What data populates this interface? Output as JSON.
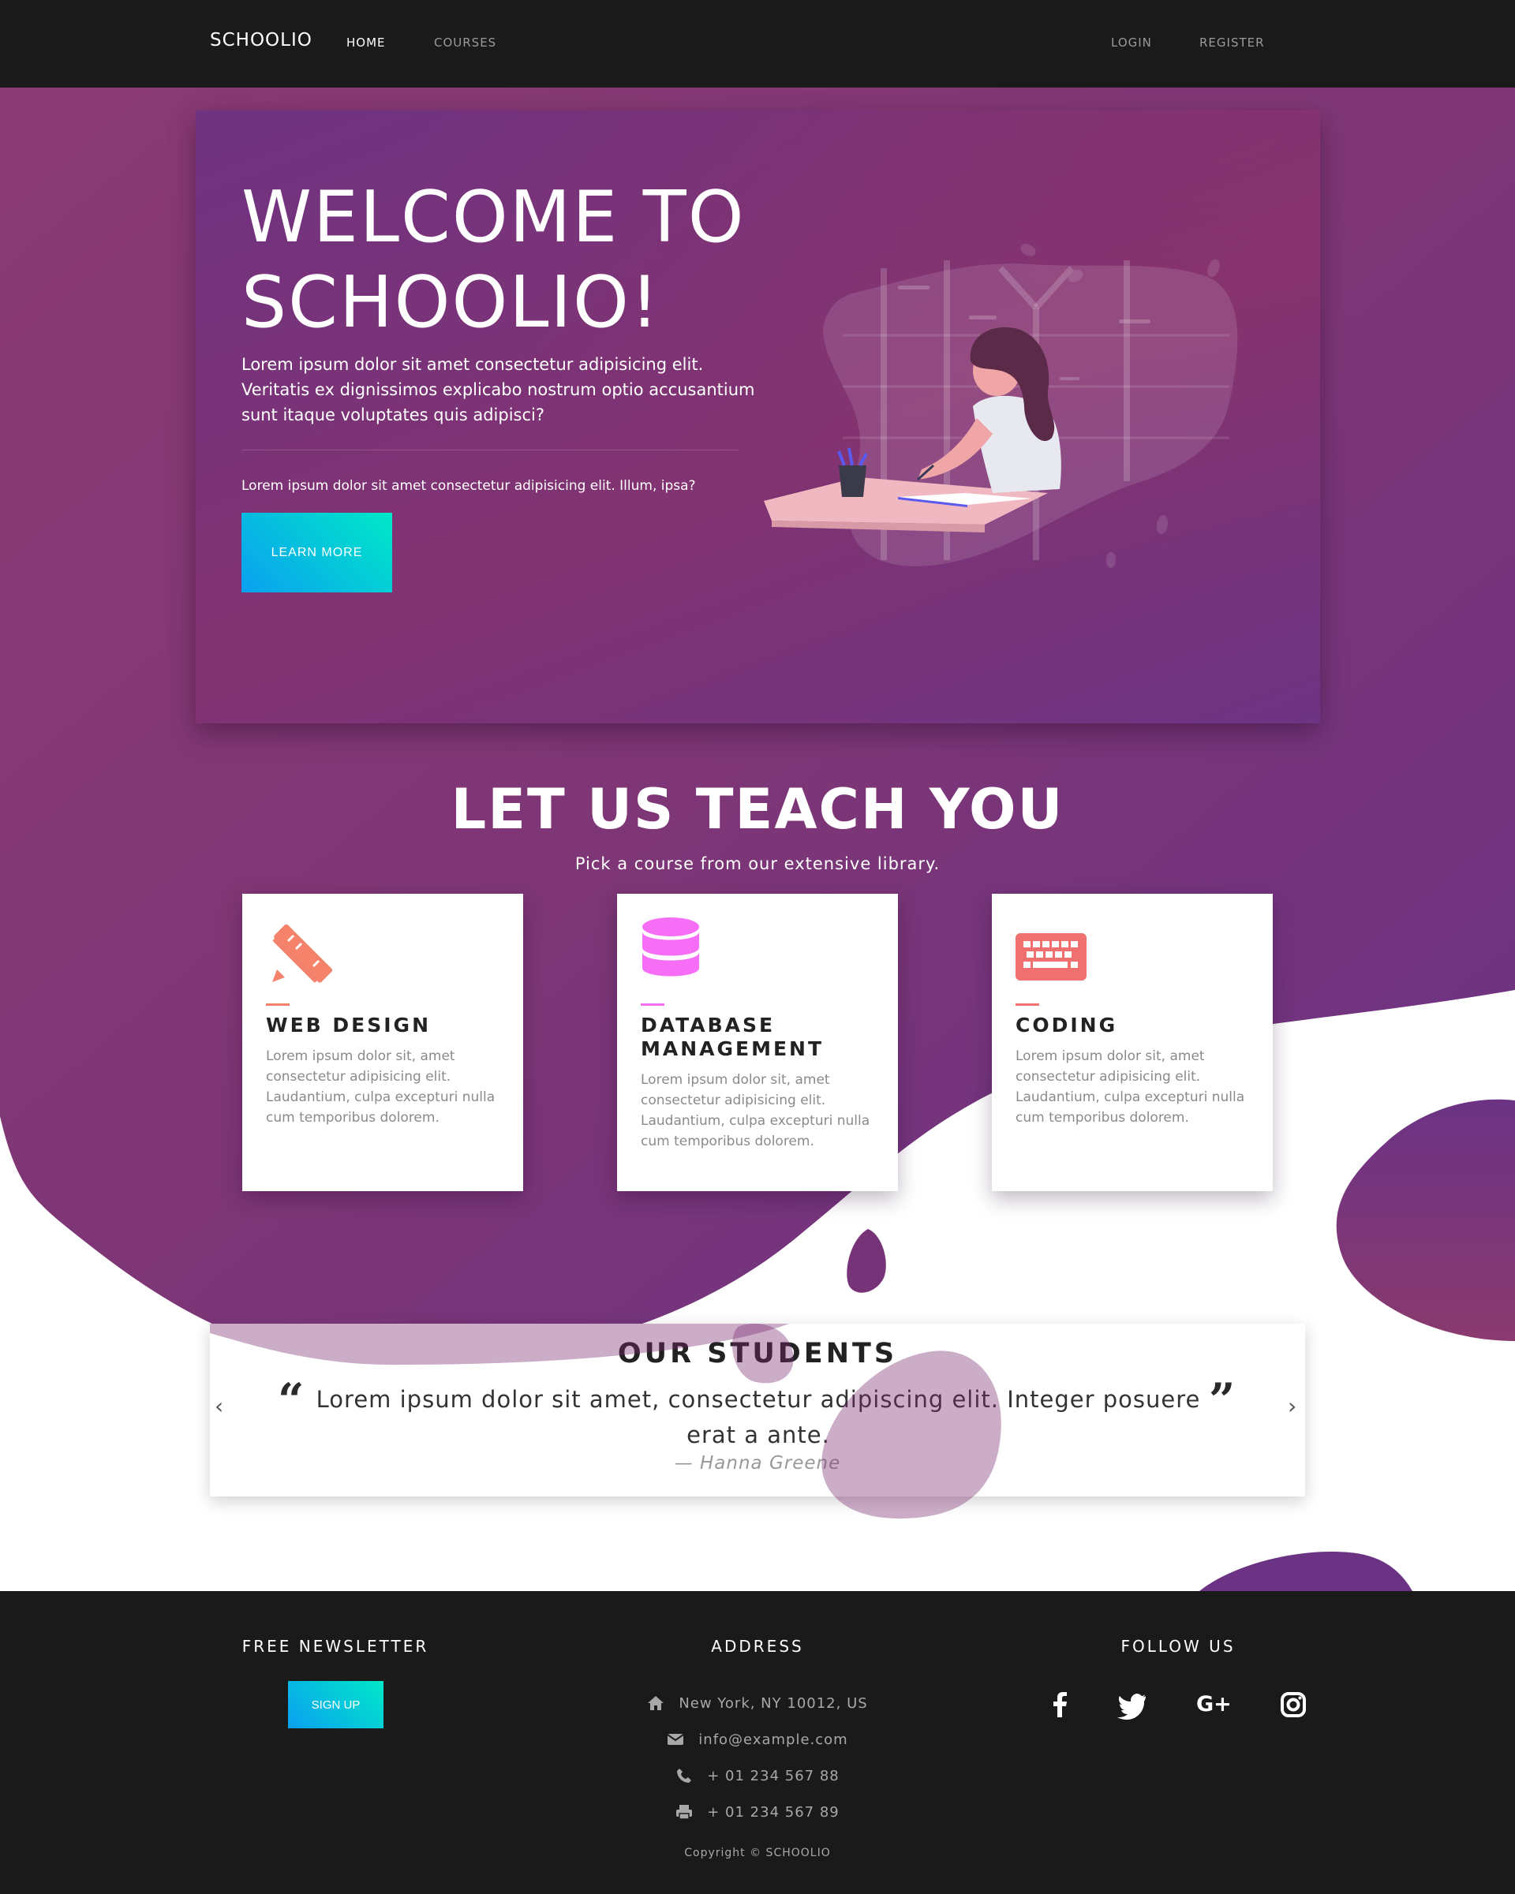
{
  "navbar": {
    "brand": "SCHOOLIO",
    "links": [
      "HOME",
      "COURSES"
    ],
    "auth": [
      "LOGIN",
      "REGISTER"
    ]
  },
  "hero": {
    "title_line1": "WELCOME TO",
    "title_line2": "SCHOOLIO!",
    "lead": "Lorem ipsum dolor sit amet consectetur adipisicing elit. Veritatis ex dignissimos explicabo nostrum optio accusantium sunt itaque voluptates quis adipisci?",
    "small": "Lorem ipsum dolor sit amet consectetur adipisicing elit. Illum, ipsa?",
    "button": "LEARN MORE"
  },
  "courses": {
    "title": "LET US TEACH YOU",
    "subtitle": "Pick a course from our extensive library.",
    "cards": [
      {
        "icon": "pencil-ruler-icon",
        "color": "#f5826a",
        "title": "WEB DESIGN",
        "desc": "Lorem ipsum dolor sit, amet consectetur adipisicing elit. Laudantium, culpa excepturi nulla cum temporibus dolorem."
      },
      {
        "icon": "database-icon",
        "color": "#f56ef5",
        "title": "DATABASE MANAGEMENT",
        "desc": "Lorem ipsum dolor sit, amet consectetur adipisicing elit. Laudantium, culpa excepturi nulla cum temporibus dolorem."
      },
      {
        "icon": "keyboard-icon",
        "color": "#f07070",
        "title": "CODING",
        "desc": "Lorem ipsum dolor sit, amet consectetur adipisicing elit. Laudantium, culpa excepturi nulla cum temporibus dolorem."
      }
    ]
  },
  "testimonial": {
    "title": "OUR STUDENTS",
    "quote": "Lorem ipsum dolor sit amet, consectetur adipiscing elit. Integer posuere erat a ante.",
    "author": "— Hanna Greene"
  },
  "footer": {
    "newsletter_heading": "FREE NEWSLETTER",
    "signup_button": "SIGN UP",
    "address_heading": "ADDRESS",
    "address": "New York, NY 10012, US",
    "email": "info@example.com",
    "phone": "+ 01 234 567 88",
    "fax": "+ 01 234 567 89",
    "follow_heading": "FOLLOW US",
    "social": [
      "facebook-icon",
      "twitter-icon",
      "google-plus-icon",
      "instagram-icon"
    ],
    "copyright": "Copyright © SCHOOLIO"
  },
  "colors": {
    "brand_purple": "#7a3377",
    "accent_gradient_start": "#0aa0f0",
    "accent_gradient_end": "#00e8c8",
    "footer_bg": "#1a1a1a"
  }
}
